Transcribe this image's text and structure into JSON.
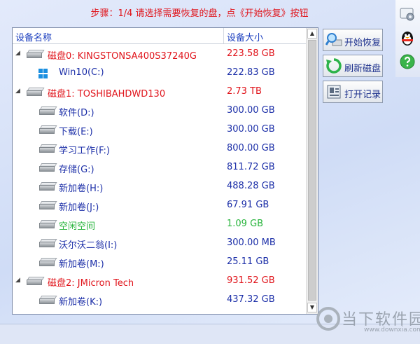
{
  "step_text": "步骤：1/4 请选择需要恢复的盘，点《开始恢复》按钮",
  "tree": {
    "headers": {
      "name": "设备名称",
      "size": "设备大小"
    },
    "rows": [
      {
        "level": 0,
        "type": "disk",
        "name": "磁盘0: KINGSTONSA400S37240G",
        "size": "223.58 GB",
        "color": "#e0141b"
      },
      {
        "level": 1,
        "type": "windows",
        "name": "Win10(C:)",
        "size": "222.83 GB",
        "color": "#1c2fa8"
      },
      {
        "level": 0,
        "type": "disk",
        "name": "磁盘1: TOSHIBAHDWD130",
        "size": "2.73 TB",
        "color": "#e0141b"
      },
      {
        "level": 1,
        "type": "drive",
        "name": "软件(D:)",
        "size": "300.00 GB",
        "color": "#1c2fa8"
      },
      {
        "level": 1,
        "type": "drive",
        "name": "下载(E:)",
        "size": "300.00 GB",
        "color": "#1c2fa8"
      },
      {
        "level": 1,
        "type": "drive",
        "name": "学习工作(F:)",
        "size": "800.00 GB",
        "color": "#1c2fa8"
      },
      {
        "level": 1,
        "type": "drive",
        "name": "存储(G:)",
        "size": "811.72 GB",
        "color": "#1c2fa8"
      },
      {
        "level": 1,
        "type": "drive",
        "name": "新加卷(H:)",
        "size": "488.28 GB",
        "color": "#1c2fa8"
      },
      {
        "level": 1,
        "type": "drive",
        "name": "新加卷(J:)",
        "size": "67.91 GB",
        "color": "#1c2fa8"
      },
      {
        "level": 1,
        "type": "drive",
        "name": "空闲空间",
        "size": "1.09 GB",
        "color": "#28b43c"
      },
      {
        "level": 1,
        "type": "drive",
        "name": "沃尔沃二翁(I:)",
        "size": "300.00 MB",
        "color": "#1c2fa8"
      },
      {
        "level": 1,
        "type": "drive",
        "name": "新加卷(M:)",
        "size": "25.11 GB",
        "color": "#1c2fa8"
      },
      {
        "level": 0,
        "type": "disk",
        "name": "磁盘2: JMicron  Tech",
        "size": "931.52 GB",
        "color": "#e0141b"
      },
      {
        "level": 1,
        "type": "drive",
        "name": "新加卷(K:)",
        "size": "437.32 GB",
        "color": "#1c2fa8"
      }
    ]
  },
  "actions": {
    "start": {
      "label": "开始恢复",
      "icon": "magnifier-icon"
    },
    "refresh": {
      "label": "刷新磁盘",
      "icon": "refresh-icon"
    },
    "open_record": {
      "label": "打开记录",
      "icon": "open-record-icon"
    }
  },
  "sidebar_icons": [
    "settings-icon",
    "qq-penguin-icon",
    "help-icon"
  ],
  "watermark": {
    "title": "当下软件园",
    "url": "www.downxia.com"
  }
}
